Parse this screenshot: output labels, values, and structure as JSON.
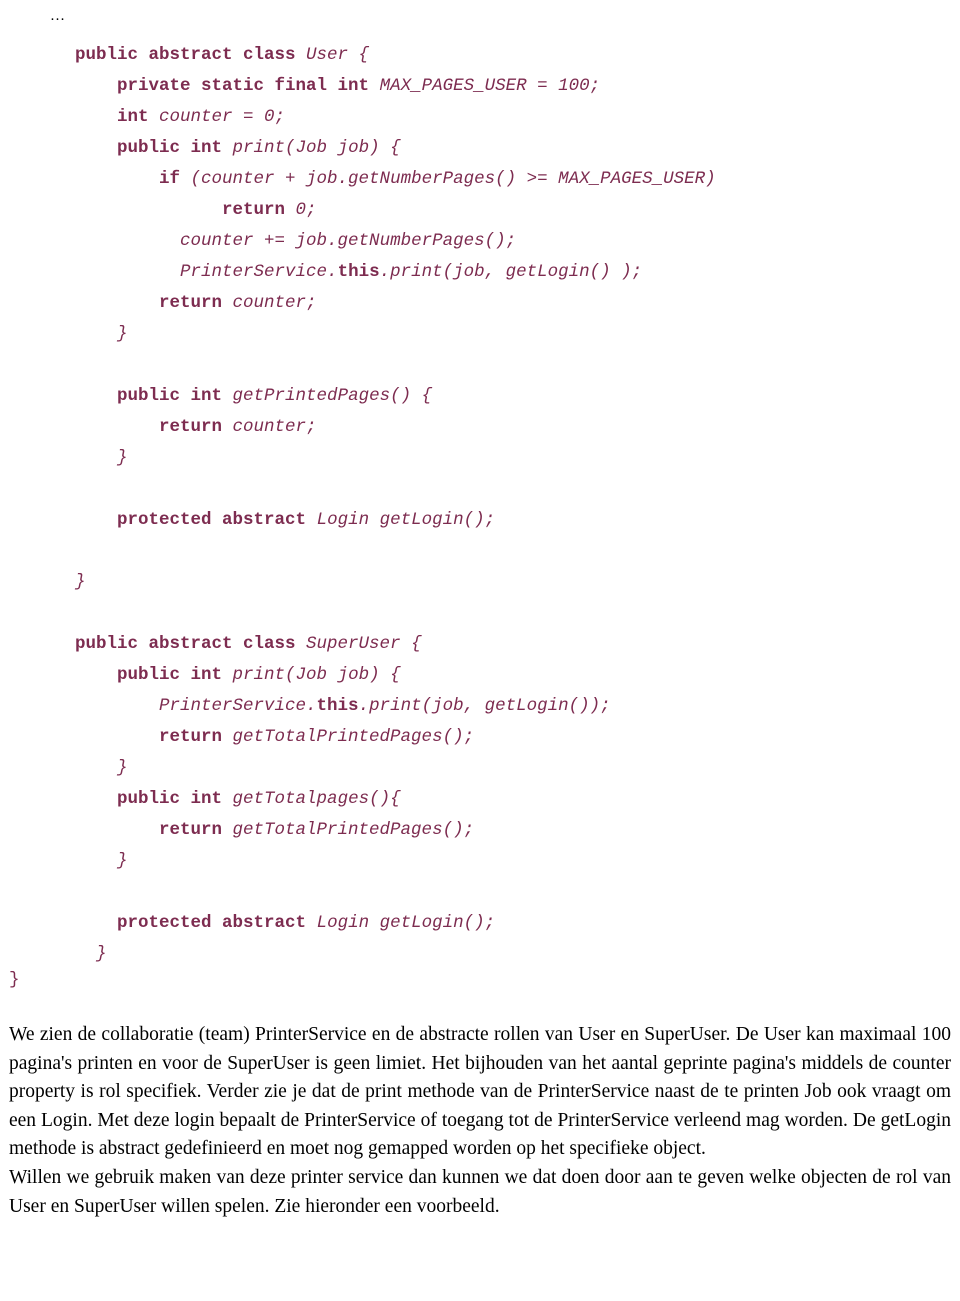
{
  "document": {
    "ellipsis": "…",
    "code_lines": [
      [
        {
          "t": "public abstract class ",
          "s": "kw"
        },
        {
          "t": "User {",
          "s": "id"
        }
      ],
      [
        {
          "t": "    ",
          "s": "plain"
        },
        {
          "t": "private static final int ",
          "s": "kw"
        },
        {
          "t": "MAX_PAGES_USER = 100;",
          "s": "id"
        }
      ],
      [
        {
          "t": "    ",
          "s": "plain"
        },
        {
          "t": "int ",
          "s": "kw"
        },
        {
          "t": "counter = 0;",
          "s": "id"
        }
      ],
      [
        {
          "t": "    ",
          "s": "plain"
        },
        {
          "t": "public int ",
          "s": "kw"
        },
        {
          "t": "print(Job job) {",
          "s": "id"
        }
      ],
      [
        {
          "t": "        ",
          "s": "plain"
        },
        {
          "t": "if ",
          "s": "kw"
        },
        {
          "t": "(counter + job.getNumberPages() >= MAX_PAGES_USER)",
          "s": "id"
        }
      ],
      [
        {
          "t": "              ",
          "s": "plain"
        },
        {
          "t": "return ",
          "s": "kw"
        },
        {
          "t": "0;",
          "s": "id"
        }
      ],
      [
        {
          "t": "          ",
          "s": "plain"
        },
        {
          "t": "counter += job.getNumberPages();",
          "s": "id"
        }
      ],
      [
        {
          "t": "          ",
          "s": "plain"
        },
        {
          "t": "PrinterService.",
          "s": "id"
        },
        {
          "t": "this",
          "s": "kw"
        },
        {
          "t": ".print(job, getLogin() );",
          "s": "id"
        }
      ],
      [
        {
          "t": "        ",
          "s": "plain"
        },
        {
          "t": "return ",
          "s": "kw"
        },
        {
          "t": "counter;",
          "s": "id"
        }
      ],
      [
        {
          "t": "    }",
          "s": "id"
        }
      ],
      [
        {
          "t": "",
          "s": "plain"
        }
      ],
      [
        {
          "t": "    ",
          "s": "plain"
        },
        {
          "t": "public int ",
          "s": "kw"
        },
        {
          "t": "getPrintedPages() {",
          "s": "id"
        }
      ],
      [
        {
          "t": "        ",
          "s": "plain"
        },
        {
          "t": "return ",
          "s": "kw"
        },
        {
          "t": "counter;",
          "s": "id"
        }
      ],
      [
        {
          "t": "    }",
          "s": "id"
        }
      ],
      [
        {
          "t": "",
          "s": "plain"
        }
      ],
      [
        {
          "t": "    ",
          "s": "plain"
        },
        {
          "t": "protected abstract ",
          "s": "kw"
        },
        {
          "t": "Login getLogin();",
          "s": "id"
        }
      ],
      [
        {
          "t": "",
          "s": "plain"
        }
      ],
      [
        {
          "t": "}",
          "s": "id"
        }
      ],
      [
        {
          "t": "",
          "s": "plain"
        }
      ],
      [
        {
          "t": "public abstract class ",
          "s": "kw"
        },
        {
          "t": "SuperUser {",
          "s": "id"
        }
      ],
      [
        {
          "t": "    ",
          "s": "plain"
        },
        {
          "t": "public int ",
          "s": "kw"
        },
        {
          "t": "print(Job job) {",
          "s": "id"
        }
      ],
      [
        {
          "t": "        ",
          "s": "plain"
        },
        {
          "t": "PrinterService.",
          "s": "id"
        },
        {
          "t": "this",
          "s": "kw"
        },
        {
          "t": ".print(job, getLogin());",
          "s": "id"
        }
      ],
      [
        {
          "t": "        ",
          "s": "plain"
        },
        {
          "t": "return ",
          "s": "kw"
        },
        {
          "t": "getTotalPrintedPages();",
          "s": "id"
        }
      ],
      [
        {
          "t": "    }",
          "s": "id"
        }
      ],
      [
        {
          "t": "    ",
          "s": "plain"
        },
        {
          "t": "public int ",
          "s": "kw"
        },
        {
          "t": "getTotalpages(){",
          "s": "id"
        }
      ],
      [
        {
          "t": "        ",
          "s": "plain"
        },
        {
          "t": "return ",
          "s": "kw"
        },
        {
          "t": "getTotalPrintedPages();",
          "s": "id"
        }
      ],
      [
        {
          "t": "    }",
          "s": "id"
        }
      ],
      [
        {
          "t": "",
          "s": "plain"
        }
      ],
      [
        {
          "t": "    ",
          "s": "plain"
        },
        {
          "t": "protected abstract ",
          "s": "kw"
        },
        {
          "t": "Login getLogin();",
          "s": "id"
        }
      ],
      [
        {
          "t": "  }",
          "s": "id"
        }
      ]
    ],
    "closing_brace": "}",
    "paragraphs": [
      "We zien de collaboratie (team) PrinterService en de abstracte rollen van User en SuperUser. De User kan maximaal 100 pagina's printen en voor de SuperUser is geen limiet. Het bijhouden van het aantal geprinte pagina's middels de counter property is rol specifiek. Verder zie je dat de print methode van de PrinterService naast de te printen Job ook vraagt om een Login. Met deze login bepaalt de PrinterService of toegang tot de PrinterService verleend mag worden. De getLogin methode is abstract gedefinieerd en moet nog gemapped worden op het specifieke object.",
      "Willen we gebruik maken van deze printer service dan kunnen we dat doen door aan te geven welke objecten de rol van User en SuperUser willen spelen. Zie hieronder een voorbeeld."
    ]
  },
  "colors": {
    "code": "#7d2c50",
    "text": "#000000",
    "background": "#ffffff"
  }
}
